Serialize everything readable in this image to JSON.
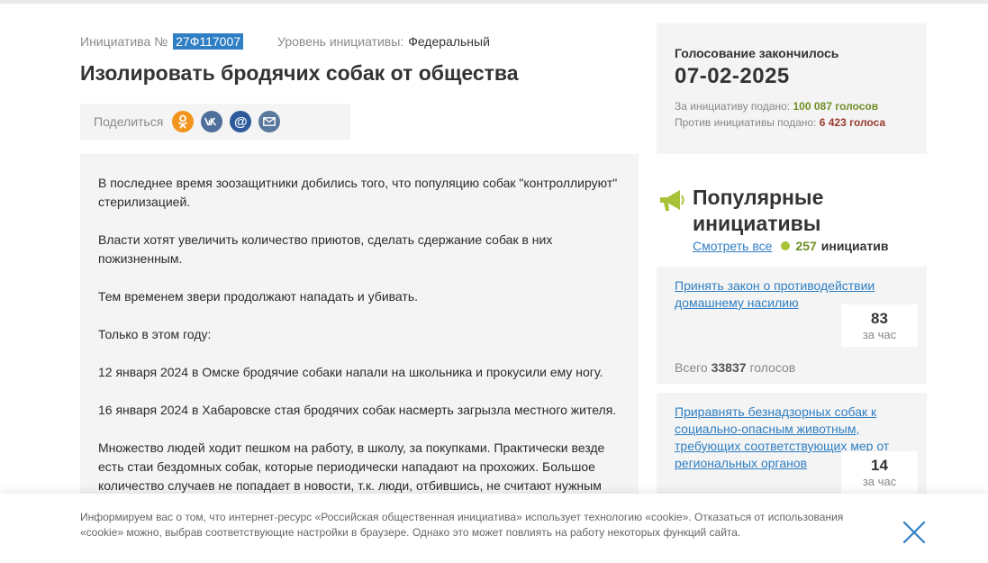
{
  "initiative": {
    "number_label": "Инициатива №",
    "number": "27Ф117007",
    "level_label": "Уровень инициативы:",
    "level_value": "Федеральный",
    "title": "Изолировать бродячих собак от общества"
  },
  "share": {
    "label": "Поделиться",
    "icons": [
      "odnoklassniki-icon",
      "vk-icon",
      "mail-ru-icon",
      "email-icon"
    ]
  },
  "content": {
    "paragraphs": [
      "В последнее время зоозащитники добились того, что популяцию собак \"контроллируют\" стерилизацией.",
      "Власти хотят увеличить количество приютов, сделать сдержание собак в них пожизненным.",
      "Тем временем звери продолжают нападать и убивать.",
      "Только в этом году:",
      "12 января 2024 в Омске бродячие собаки напали на школьника и прокусили ему ногу.",
      "16 января 2024 в Хабаровске стая бродячих собак насмерть загрызла местного жителя.",
      "Множество людей ходит пешком на работу, в школу, за покупками. Практически везде есть стаи бездомных собак, которые периодически нападают на прохожих. Большое количество случаев не попадает в новости, т.к. люди, отбившись, не считают нужным"
    ]
  },
  "vote": {
    "title": "Голосование закончилось",
    "date": "07-02-2025",
    "for_label": "За инициативу подано:",
    "for_value": "100 087 голосов",
    "against_label": "Против инициативы подано:",
    "against_value": "6 423 голоса"
  },
  "popular": {
    "title": "Популярные инициативы",
    "see_all": "Смотреть все",
    "count": "257",
    "count_word": "инициатив",
    "cards": [
      {
        "title": "Принять закон о противодействии домашнему насилию",
        "rate": "83",
        "rate_unit": "за час",
        "total_label": "Всего",
        "total_value": "33837",
        "total_suffix": "голосов"
      },
      {
        "title": "Приравнять безнадзорных собак к социально-опасным животным, требующих соответствующих мер от региональных органов",
        "rate": "14",
        "rate_unit": "за час"
      }
    ]
  },
  "cookie": {
    "text": "Информируем вас о том, что интернет-ресурс «Российская общественная инициатива» использует технологию «cookie». Отказаться от использования «cookie» можно, выбрав соответствующие настройки в браузере. Однако это может повлиять на работу некоторых функций сайта."
  },
  "colors": {
    "accent_blue": "#2f7fc4",
    "panel_gray": "#f4f4f4",
    "vote_green": "#6f8f27",
    "vote_red": "#9b3a2e",
    "megaphone_green": "#a8c23a"
  }
}
